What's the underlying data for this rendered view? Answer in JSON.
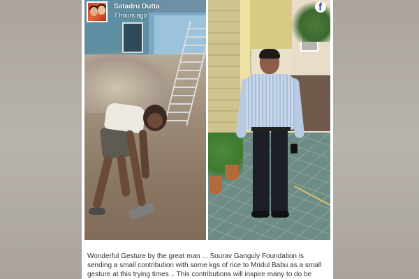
{
  "post": {
    "author": "Satadru Dutta",
    "time": "7 hours ago",
    "platform_icon": "facebook-icon",
    "caption_lines": [
      "Wonderful Gesture by the great man ... Sourav Ganguly Foundation is",
      "sending a small contribution with some kgs of rice to Mridul Babu as a small",
      "gesture at this trying times .. This contributions will inspire many to do be"
    ]
  },
  "colors": {
    "page_background": "#b3aea7",
    "card_background": "#ffffff",
    "caption_text": "#333333",
    "facebook_blue": "#3b5998"
  }
}
